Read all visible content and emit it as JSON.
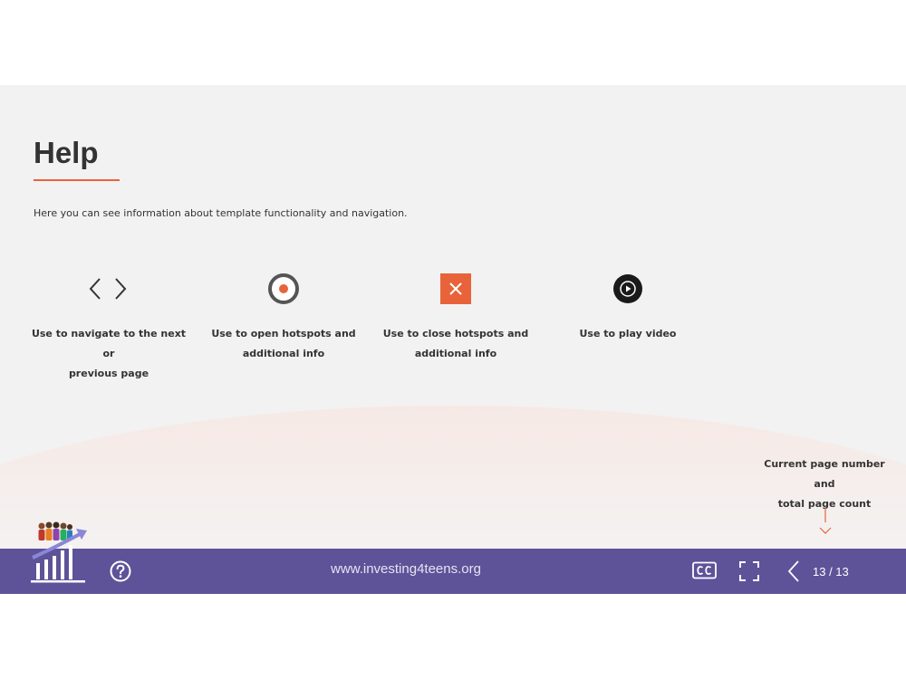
{
  "slide": {
    "title": "Help",
    "intro": "Here you can see information about template functionality and navigation."
  },
  "features": [
    {
      "icon": "chevron-left-right-icon",
      "caption_line1": "Use to navigate to the next or",
      "caption_line2": "previous page"
    },
    {
      "icon": "hotspot-open-icon",
      "caption_line1": "Use to open hotspots and",
      "caption_line2": "additional info"
    },
    {
      "icon": "close-icon",
      "caption_line1": "Use to close hotspots and",
      "caption_line2": "additional info"
    },
    {
      "icon": "play-icon",
      "caption_line1": "Use to play video",
      "caption_line2": ""
    }
  ],
  "annotation": {
    "line1": "Current page number and",
    "line2": "total page count"
  },
  "bottom_bar": {
    "url": "www.investing4teens.org",
    "page_counter": "13 / 13"
  },
  "colors": {
    "accent": "#e8633a",
    "bar": "#5e5399",
    "background": "#f2f2f2",
    "text": "#333333"
  }
}
